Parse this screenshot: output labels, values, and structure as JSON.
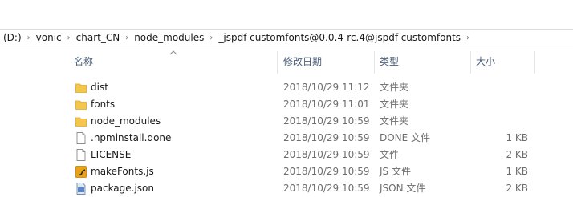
{
  "address": {
    "crumbs": [
      "(D:)",
      "vonic",
      "chart_CN",
      "node_modules",
      "_jspdf-customfonts@0.0.4-rc.4@jspdf-customfonts"
    ]
  },
  "columns": {
    "name": "名称",
    "date": "修改日期",
    "type": "类型",
    "size": "大小"
  },
  "files": [
    {
      "name": "dist",
      "date": "2018/10/29 11:12",
      "type": "文件夹",
      "size": "",
      "icon": "folder-icon"
    },
    {
      "name": "fonts",
      "date": "2018/10/29 11:01",
      "type": "文件夹",
      "size": "",
      "icon": "folder-icon"
    },
    {
      "name": "node_modules",
      "date": "2018/10/29 10:59",
      "type": "文件夹",
      "size": "",
      "icon": "folder-icon"
    },
    {
      "name": ".npminstall.done",
      "date": "2018/10/29 10:59",
      "type": "DONE 文件",
      "size": "1 KB",
      "icon": "file-icon"
    },
    {
      "name": "LICENSE",
      "date": "2018/10/29 10:59",
      "type": "文件",
      "size": "2 KB",
      "icon": "file-icon"
    },
    {
      "name": "makeFonts.js",
      "date": "2018/10/29 10:59",
      "type": "JS 文件",
      "size": "1 KB",
      "icon": "js-file-icon"
    },
    {
      "name": "package.json",
      "date": "2018/10/29 10:59",
      "type": "JSON 文件",
      "size": "2 KB",
      "icon": "json-file-icon"
    }
  ],
  "colors": {
    "folder": "#f4c64c",
    "header_text": "#4c607a",
    "detail_text": "#6d6d6d",
    "js_icon": "#e8a317"
  }
}
